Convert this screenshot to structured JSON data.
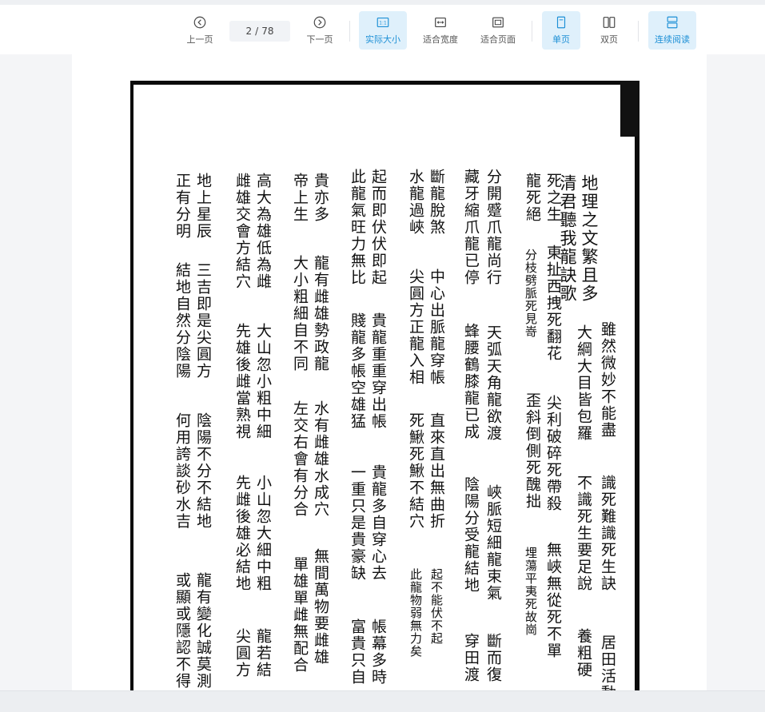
{
  "toolbar": {
    "prev_label": "上一页",
    "next_label": "下一页",
    "current_page": "2",
    "page_separator": "/",
    "total_pages": "78",
    "actual_size_label": "实际大小",
    "fit_width_label": "适合宽度",
    "fit_page_label": "适合页面",
    "single_page_label": "单页",
    "double_page_label": "双页",
    "continuous_label": "连续阅读",
    "actual_size_icon_text": "1:1",
    "accent_color": "#1e90d6",
    "active_bg": "#dff0fb"
  },
  "document": {
    "columns": [
      {
        "id": "c1a",
        "text": "地理之文繁且多"
      },
      {
        "id": "c1b",
        "text": "雖然微妙不能盡"
      },
      {
        "id": "c1c",
        "text": "居田活動"
      },
      {
        "id": "c2a",
        "text": "清君聽我龍訣歌"
      },
      {
        "id": "c2b",
        "text": "大綱大目皆包羅"
      },
      {
        "id": "c2c",
        "text": "不識死生要足說"
      },
      {
        "id": "c2d",
        "text": "識死難識死生訣"
      },
      {
        "id": "c2e",
        "text": "養粗硬"
      },
      {
        "id": "c3a",
        "text": "死之生"
      },
      {
        "id": "c3b",
        "text": "東扯西拽死翻花"
      },
      {
        "id": "c3c",
        "text": "尖利破碎死帶殺"
      },
      {
        "id": "c3d",
        "text": "無峽無從死不單"
      },
      {
        "id": "c4a",
        "text": "龍死絕"
      },
      {
        "id": "c4b",
        "text": "分枝劈脈死見嵜"
      },
      {
        "id": "c4c",
        "text": "歪斜倒側死醜拙"
      },
      {
        "id": "c4d",
        "text": "埋蕩平夷死故崗"
      },
      {
        "id": "c5a",
        "text": "分開蹙爪龍尚行"
      },
      {
        "id": "c5b",
        "text": "天弧天角龍欲渡"
      },
      {
        "id": "c5c",
        "text": "峽脈短細龍束氣"
      },
      {
        "id": "c5d",
        "text": "斷而復"
      },
      {
        "id": "c6a",
        "text": "藏牙縮爪龍已停"
      },
      {
        "id": "c6b",
        "text": "蜂腰鶴膝龍已成"
      },
      {
        "id": "c6c",
        "text": "陰陽分受龍結地"
      },
      {
        "id": "c6d",
        "text": "穿田渡"
      },
      {
        "id": "c7a",
        "text": "斷龍脫煞"
      },
      {
        "id": "c7b",
        "text": "中心出脈龍穿帳"
      },
      {
        "id": "c7c",
        "text": "直來直出無曲折"
      },
      {
        "id": "c7d",
        "text": "起不能伏不起"
      },
      {
        "id": "c8a",
        "text": "水龍過峽"
      },
      {
        "id": "c8b",
        "text": "尖圓方正龍入相"
      },
      {
        "id": "c8c",
        "text": "死鰍死鰍不結穴"
      },
      {
        "id": "c8d",
        "text": "此龍物弱無力矣"
      },
      {
        "id": "c9a",
        "text": "起而即伏伏即起"
      },
      {
        "id": "c9b",
        "text": "貴龍重重穿出帳"
      },
      {
        "id": "c9c",
        "text": "貴龍多自穿心去"
      },
      {
        "id": "c9d",
        "text": "帳幕多時"
      },
      {
        "id": "c10a",
        "text": "此龍氣旺力無比"
      },
      {
        "id": "c10b",
        "text": "賤龍多帳空雄猛"
      },
      {
        "id": "c10c",
        "text": "一重只是貴豪缺"
      },
      {
        "id": "c10d",
        "text": "富貴只自"
      },
      {
        "id": "c11a",
        "text": "貴亦多"
      },
      {
        "id": "c11b",
        "text": "龍有雌雄勢政龍"
      },
      {
        "id": "c11c",
        "text": "水有雌雄水成穴"
      },
      {
        "id": "c11d",
        "text": "無間萬物要雌雄"
      },
      {
        "id": "c12a",
        "text": "帝上生"
      },
      {
        "id": "c12b",
        "text": "大小粗細自不同"
      },
      {
        "id": "c12c",
        "text": "左交右會有分合"
      },
      {
        "id": "c12d",
        "text": "單雄單雌無配合"
      },
      {
        "id": "c13a",
        "text": "高大為雄低為雌"
      },
      {
        "id": "c13b",
        "text": "大山忽小粗中細"
      },
      {
        "id": "c13c",
        "text": "小山忽大細中粗"
      },
      {
        "id": "c13d",
        "text": "龍若結"
      },
      {
        "id": "c14a",
        "text": "雌雄交會方結穴"
      },
      {
        "id": "c14b",
        "text": "先雄後雌當熟視"
      },
      {
        "id": "c14c",
        "text": "先雌後雄必結地"
      },
      {
        "id": "c14d",
        "text": "尖圓方"
      },
      {
        "id": "c15a",
        "text": "地上星辰"
      },
      {
        "id": "c15b",
        "text": "三吉即是尖圓方"
      },
      {
        "id": "c15c",
        "text": "陰陽不分不結地"
      },
      {
        "id": "c15d",
        "text": "龍有變化誠莫測"
      },
      {
        "id": "c16a",
        "text": "正有分明"
      },
      {
        "id": "c16b",
        "text": "結地自然分陰陽"
      },
      {
        "id": "c16c",
        "text": "何用誇談砂水吉"
      },
      {
        "id": "c16d",
        "text": "或顯或隱認不得"
      }
    ]
  }
}
